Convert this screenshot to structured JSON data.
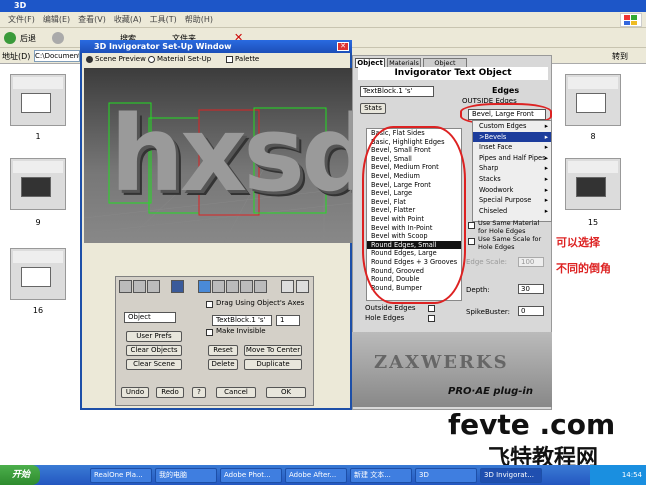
{
  "explorer": {
    "title": "3D",
    "menu": [
      "文件(F)",
      "编辑(E)",
      "查看(V)",
      "收藏(A)",
      "工具(T)",
      "帮助(H)"
    ],
    "toolbar": {
      "back": "后退",
      "search": "搜索",
      "folders": "文件夹"
    },
    "address_label": "地址(D)",
    "address_value": "C:\\Documents",
    "go_label": "转到",
    "thumbs_left": [
      "1",
      "9",
      "16"
    ],
    "thumbs_right": [
      "8",
      "15"
    ]
  },
  "taskbar": {
    "start": "开始",
    "tasks": [
      "RealOne Pla...",
      "我的电脑",
      "Adobe Phot...",
      "Adobe After...",
      "新建 文本...",
      "3D",
      "3D Invigorat..."
    ],
    "clock": "14:54"
  },
  "win3d": {
    "title": "3D Invigorator Set-Up Window",
    "tabs": [
      "Scene Preview",
      "Material Set-Up",
      "Palette"
    ],
    "preview_text": "hxsd",
    "object_select": "Object",
    "text_select": "TextBlock.1 's'",
    "text_index": "1",
    "drag_axes": "Drag Using Object's Axes",
    "make_invisible": "Make Invisible",
    "buttons": {
      "user_prefs": "User Prefs",
      "clear_objects": "Clear Objects",
      "clear_scene": "Clear Scene",
      "reset": "Reset",
      "move_to_center": "Move To Center",
      "delete": "Delete",
      "duplicate": "Duplicate",
      "undo": "Undo",
      "redo": "Redo",
      "help": "?",
      "cancel": "Cancel",
      "ok": "OK"
    }
  },
  "rpanel": {
    "tabs": [
      "Object",
      "Materials",
      "Object Styles"
    ],
    "header": "Invigorator Text Object",
    "textblock": "TextBlock.1 's'",
    "stats": "Stats",
    "edges_label": "Edges",
    "outside_edges": "OUTSIDE Edges",
    "bevel_value": "Bevel, Large Front",
    "dropdown": [
      "Basic, Flat Sides",
      "Basic, Highlight Edges",
      "Bevel, Small Front",
      "Bevel, Small",
      "Bevel, Medium Front",
      "Bevel, Medium",
      "Bevel, Large Front",
      "Bevel, Large",
      "Bevel, Flat",
      "Bevel, Flatter",
      "Bevel with Point",
      "Bevel with In-Point",
      "Bevel with Scoop",
      "Round Edges, Small",
      "Round Edges, Large",
      "Round Edges + 3 Grooves",
      "Round, Grooved",
      "Round, Double",
      "Round, Bumper"
    ],
    "submenu": [
      "Custom Edges",
      ">Bevels",
      "Inset Face",
      "Pipes and Half Pipes",
      "Sharp",
      "Stacks",
      "Woodwork",
      "Special Purpose",
      "Chiseled"
    ],
    "same_material": "Use Same Material for Hole Edges",
    "same_scale": "Use Same Scale for Hole Edges",
    "edge_scale": "Edge Scale:",
    "edge_scale_val": "100",
    "depth": "Depth:",
    "depth_val": "30",
    "spikebuster": "SpikeBuster:",
    "spikebuster_val": "0",
    "outside_edges2": "Outside Edges",
    "hole_edges": "Hole Edges",
    "brand": "ZAXWERKS",
    "plugin": "PRO·AE plug-in"
  },
  "annotation": {
    "line1": "可以选择",
    "line2": "不同的倒角"
  },
  "watermark": {
    "latin": "fevte .com",
    "chinese": "飞特教程网"
  },
  "colors": {
    "titlebar": "#1d56c8",
    "annotation_red": "#d22222",
    "highlight": "#1c3c9c"
  }
}
